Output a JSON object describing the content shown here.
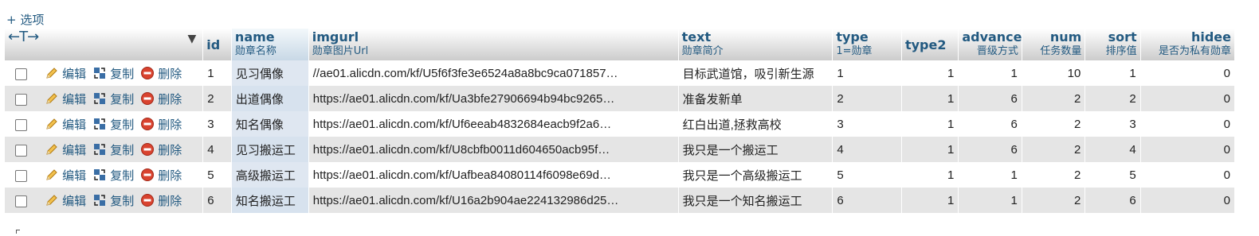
{
  "options_link": "+ 选项",
  "header": {
    "arrows": "←T→",
    "menu_icon": "caret-down-icon",
    "columns": [
      {
        "name": "id",
        "sub": ""
      },
      {
        "name": "name",
        "sub": "勋章名称"
      },
      {
        "name": "imgurl",
        "sub": "勋章图片Url"
      },
      {
        "name": "text",
        "sub": "勋章简介"
      },
      {
        "name": "type",
        "sub": "1=勋章"
      },
      {
        "name": "type2",
        "sub": ""
      },
      {
        "name": "advance",
        "sub": "晋级方式"
      },
      {
        "name": "num",
        "sub": "任务数量"
      },
      {
        "name": "sort",
        "sub": "排序值"
      },
      {
        "name": "hidee",
        "sub": "是否为私有勋章"
      }
    ]
  },
  "actions": {
    "edit": "编辑",
    "copy": "复制",
    "delete": "删除"
  },
  "colors": {
    "link": "#235a81",
    "row_even": "#e5e5e5",
    "marked": "#d7e2ee"
  },
  "rows": [
    {
      "id": "1",
      "name": "见习偶像",
      "imgurl": "//ae01.alicdn.com/kf/U5f6f3fe3e6524a8a8bc9ca071857…",
      "text": "目标武道馆，吸引新生源",
      "type": "1",
      "type2": "1",
      "advance": "1",
      "num": "10",
      "sort": "1",
      "hidee": "0"
    },
    {
      "id": "2",
      "name": "出道偶像",
      "imgurl": "https://ae01.alicdn.com/kf/Ua3bfe27906694b94bc9265…",
      "text": "准备发新单",
      "type": "2",
      "type2": "1",
      "advance": "6",
      "num": "2",
      "sort": "2",
      "hidee": "0"
    },
    {
      "id": "3",
      "name": "知名偶像",
      "imgurl": "https://ae01.alicdn.com/kf/Uf6eeab4832684eacb9f2a6…",
      "text": "红白出道,拯救高校",
      "type": "3",
      "type2": "1",
      "advance": "6",
      "num": "2",
      "sort": "3",
      "hidee": "0"
    },
    {
      "id": "4",
      "name": "见习搬运工",
      "imgurl": "https://ae01.alicdn.com/kf/U8cbfb0011d604650acb95f…",
      "text": "我只是一个搬运工",
      "type": "4",
      "type2": "1",
      "advance": "6",
      "num": "2",
      "sort": "4",
      "hidee": "0"
    },
    {
      "id": "5",
      "name": "高级搬运工",
      "imgurl": "https://ae01.alicdn.com/kf/Uafbea84080114f6098e69d…",
      "text": "我只是一个高级搬运工",
      "type": "5",
      "type2": "1",
      "advance": "1",
      "num": "2",
      "sort": "5",
      "hidee": "0"
    },
    {
      "id": "6",
      "name": "知名搬运工",
      "imgurl": "https://ae01.alicdn.com/kf/U16a2b904ae224132986d25…",
      "text": "我只是一个知名搬运工",
      "type": "6",
      "type2": "1",
      "advance": "1",
      "num": "2",
      "sort": "6",
      "hidee": "0"
    }
  ]
}
